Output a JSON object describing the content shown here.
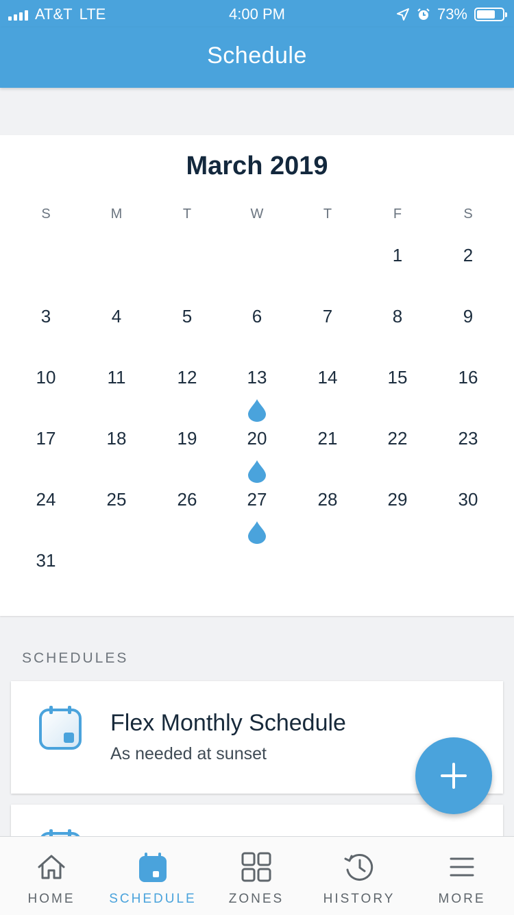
{
  "status_bar": {
    "carrier": "AT&T",
    "network": "LTE",
    "time": "4:00 PM",
    "battery_percent": "73%",
    "battery_level": 0.73
  },
  "header": {
    "title": "Schedule"
  },
  "calendar": {
    "month_label": "March 2019",
    "weekdays": [
      "S",
      "M",
      "T",
      "W",
      "T",
      "F",
      "S"
    ],
    "first_weekday_index": 5,
    "days_in_month": 31,
    "watering_days": [
      13,
      20,
      27
    ],
    "accent_color": "#4aa3dc"
  },
  "schedules_section": {
    "label": "SCHEDULES",
    "items": [
      {
        "name": "Flex Monthly Schedule",
        "subtitle": "As needed at sunset",
        "icon": "calendar-icon"
      }
    ]
  },
  "fab": {
    "icon": "plus-icon"
  },
  "tab_bar": {
    "tabs": [
      {
        "label": "HOME",
        "icon": "home-icon",
        "active": false
      },
      {
        "label": "SCHEDULE",
        "icon": "calendar-icon",
        "active": true
      },
      {
        "label": "ZONES",
        "icon": "grid-icon",
        "active": false
      },
      {
        "label": "HISTORY",
        "icon": "history-icon",
        "active": false
      },
      {
        "label": "MORE",
        "icon": "menu-icon",
        "active": false
      }
    ]
  },
  "colors": {
    "brand": "#4aa3dc",
    "background": "#f1f2f4",
    "text": "#1b2b3a"
  }
}
